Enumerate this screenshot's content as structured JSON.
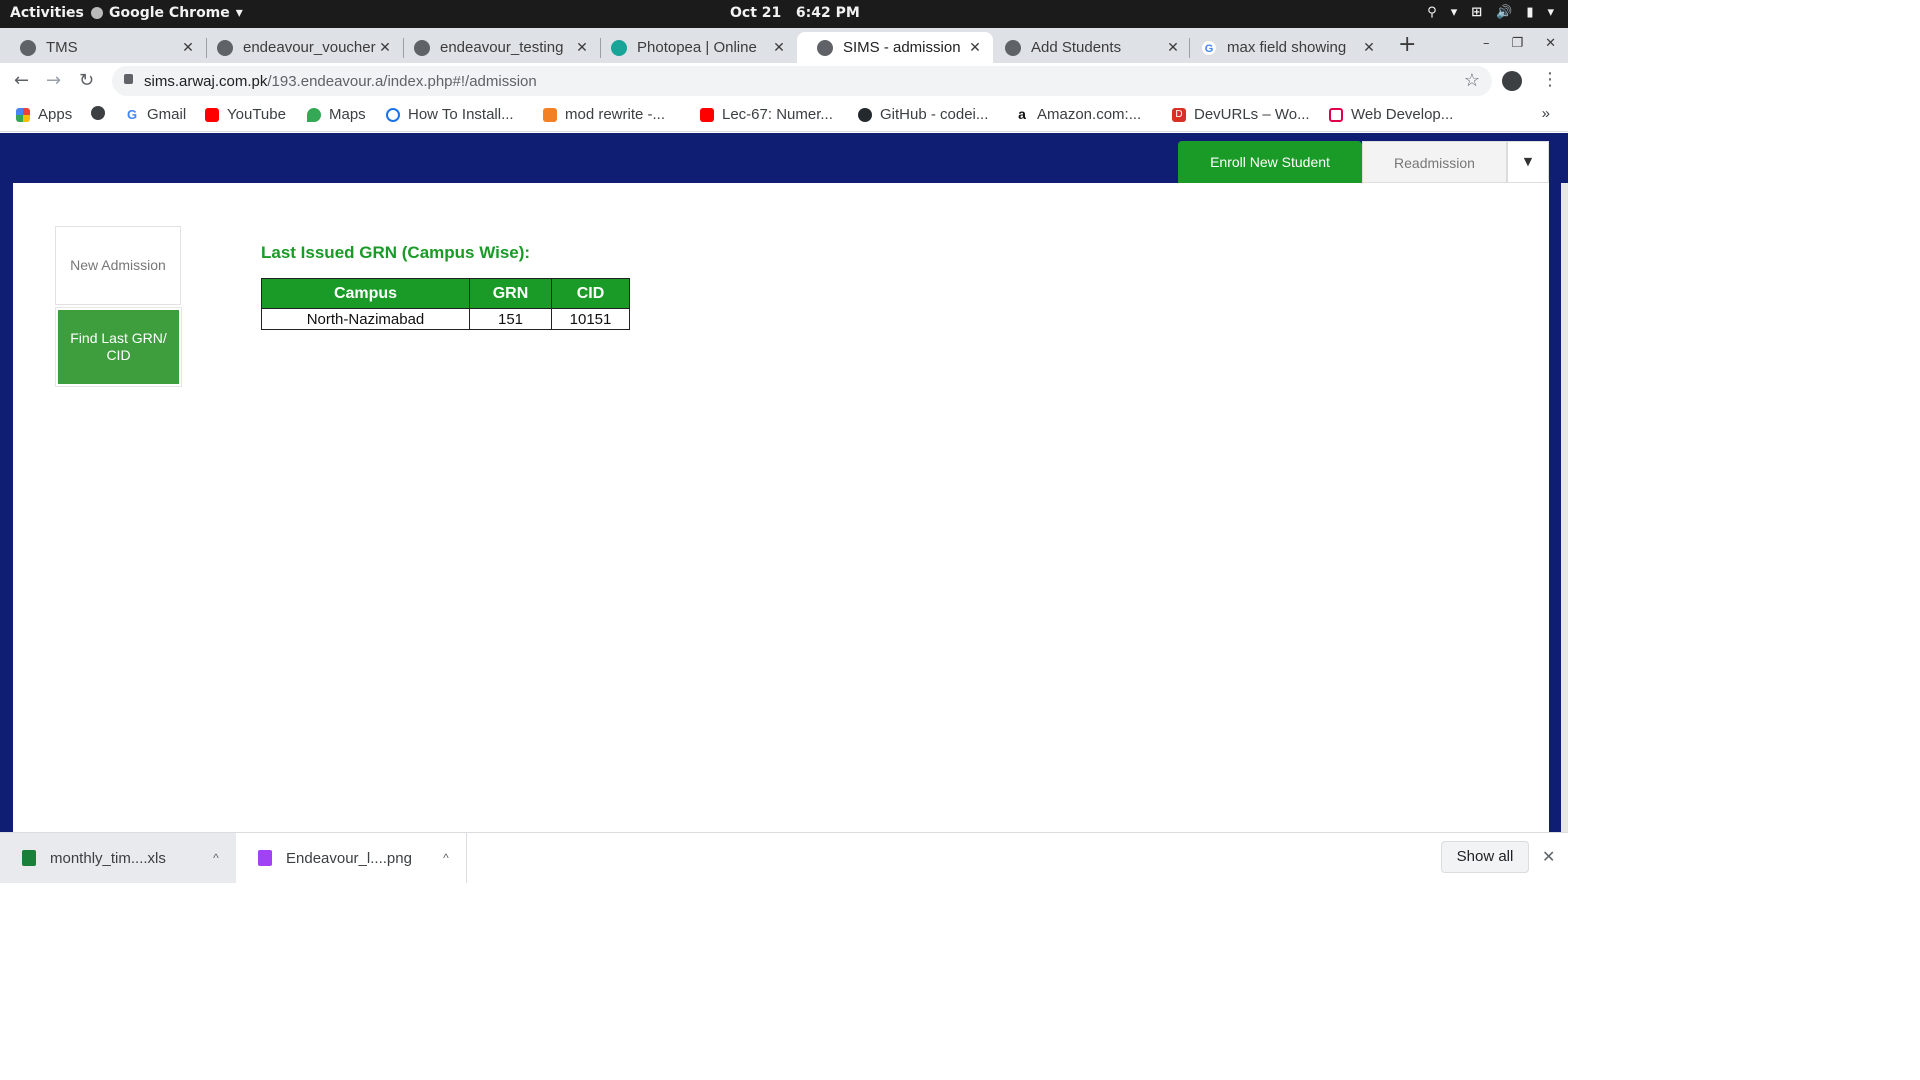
{
  "os": {
    "activities": "Activities",
    "app_name": "Google Chrome",
    "app_menu_caret": "▾",
    "date": "Oct 21",
    "time": "6:42 PM",
    "tray": [
      "⚲",
      "▾",
      "⊞",
      "🔊",
      "▮",
      "▾"
    ]
  },
  "tabs": [
    {
      "title": "TMS",
      "icon": "globe-icon"
    },
    {
      "title": "endeavour_voucher",
      "icon": "globe-icon"
    },
    {
      "title": "endeavour_testing",
      "icon": "globe-icon"
    },
    {
      "title": "Photopea | Online",
      "icon": "photopea-icon"
    },
    {
      "title": "SIMS - admission",
      "icon": "globe-icon"
    },
    {
      "title": "Add Students",
      "icon": "globe-icon"
    },
    {
      "title": "max field showing",
      "icon": "google-icon"
    }
  ],
  "tab_close_glyph": "✕",
  "new_tab_glyph": "+",
  "window_controls": [
    "–",
    "❐",
    "✕"
  ],
  "nav": {
    "back": "←",
    "forward": "→",
    "reload": "↻"
  },
  "address": {
    "host": "sims.arwaj.com.pk",
    "path": "/193.endeavour.a/index.php#!/admission",
    "star": "☆"
  },
  "menu_glyph": "⋮",
  "bookmarks": [
    {
      "label": "Apps",
      "color": "#ea4335"
    },
    {
      "label": "",
      "color": "#3c4043"
    },
    {
      "label": "Gmail",
      "color": "#4285f4"
    },
    {
      "label": "YouTube",
      "color": "#ff0000"
    },
    {
      "label": "Maps",
      "color": "#34a853"
    },
    {
      "label": "How To Install...",
      "color": "#1a73e8"
    },
    {
      "label": "mod rewrite -...",
      "color": "#f48024"
    },
    {
      "label": "Lec-67: Numer...",
      "color": "#ff0000"
    },
    {
      "label": "GitHub - codei...",
      "color": "#24292e"
    },
    {
      "label": "Amazon.com:...",
      "color": "#111111"
    },
    {
      "label": "DevURLs – Wo...",
      "color": "#d93025"
    },
    {
      "label": "Web Develop...",
      "color": "#e0004d"
    }
  ],
  "bookmarks_more": "»",
  "page": {
    "enroll_button": "Enroll New Student",
    "readmission_button": "Readmission",
    "dropdown_caret": "▼",
    "side_new_admission": "New Admission",
    "side_find_last": "Find Last GRN/ CID",
    "grn_heading": "Last Issued GRN (Campus Wise):",
    "table": {
      "headers": [
        "Campus",
        "GRN",
        "CID"
      ],
      "rows": [
        [
          "North-Nazimabad",
          "151",
          "10151"
        ]
      ]
    },
    "accent_color": "#1a9a27",
    "header_color": "#0f1e73"
  },
  "downloads": [
    {
      "name": "monthly_tim....xls",
      "icon": "spreadsheet-icon",
      "color": "#188038"
    },
    {
      "name": "Endeavour_l....png",
      "icon": "image-file-icon",
      "color": "#a142f4"
    }
  ],
  "download_chevron": "^",
  "show_all": "Show all",
  "shelf_close": "✕"
}
